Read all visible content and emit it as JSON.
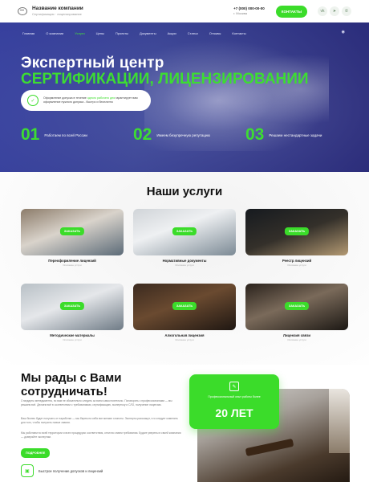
{
  "header": {
    "company_name": "Название компании",
    "company_sub": "Сертификация · лицензирование",
    "phone": "+7 (000) 000-00-00",
    "city": "г. Москва",
    "contacts_button": "КОНТАКТЫ",
    "social": [
      "vk-icon",
      "telegram-icon",
      "whatsapp-icon"
    ]
  },
  "nav": {
    "items": [
      "Главная",
      "О компании",
      "Услуги",
      "Цены",
      "Проекты",
      "Документы",
      "Акции",
      "Статьи",
      "Отзывы",
      "Контакты"
    ],
    "active": "Услуги"
  },
  "hero": {
    "title_line1": "Экспертный центр",
    "title_line2": "СЕРТИФИКАЦИИ, ЛИЦЕНЗИРОВАНИИ",
    "pill_text_a": "Оформление допуска в течение ",
    "pill_text_link": "одного рабочего дня",
    "pill_text_b": " гарантирует вам оформление нужного допуска - быстро и бесплатно",
    "stats": [
      {
        "num": "01",
        "label": "Работаем по всей России"
      },
      {
        "num": "02",
        "label": "Имеем безупречную репутацию"
      },
      {
        "num": "03",
        "label": "Решаем нестандартные задачи"
      }
    ]
  },
  "services": {
    "title": "Наши услуги",
    "order_label": "ЗАКАЗАТЬ",
    "cards": [
      {
        "name": "Переоформление лицензий",
        "sub": "Описание услуги"
      },
      {
        "name": "Нормативные документы",
        "sub": "Описание услуги"
      },
      {
        "name": "Реестр лицензий",
        "sub": "Описание услуги"
      },
      {
        "name": "Методические материалы",
        "sub": "Описание услуги"
      },
      {
        "name": "Алкогольная лицензия",
        "sub": "Описание услуги"
      },
      {
        "name": "Лицензия связи",
        "sub": "Описание услуги"
      }
    ]
  },
  "about": {
    "title": "Мы рады с Вами сотрудничать!",
    "p1": "Стандарты менеджмента, но вам не обязательно следить за всем самостоятельно. Поговорить с профессионалами — мы решаем всё. Делаем всё в соответствии с требованиями, сертификацию, экспертизу и СЛО, получение лицензии.",
    "p2": "Ваш бизнес будет получать от наработки — мы берем на себя все мелкие хлопоты. Эксперты расскажут, что следует изменить для того, чтобы получить новые знания.",
    "p3": "Мы работаем по всей территории и всех процедурах соответствия, отлично знаем требования. Будьте уверены в своей компании — доверяйте экспертам.",
    "button": "ПОДРОБНЕЕ",
    "feature": "Быстрое получение допусков и лицензий",
    "badge_label": "Профессиональный опыт работы более",
    "badge_years": "20 ЛЕТ"
  },
  "colors": {
    "accent": "#3bdc2a",
    "hero_overlay": "#3842aa"
  }
}
